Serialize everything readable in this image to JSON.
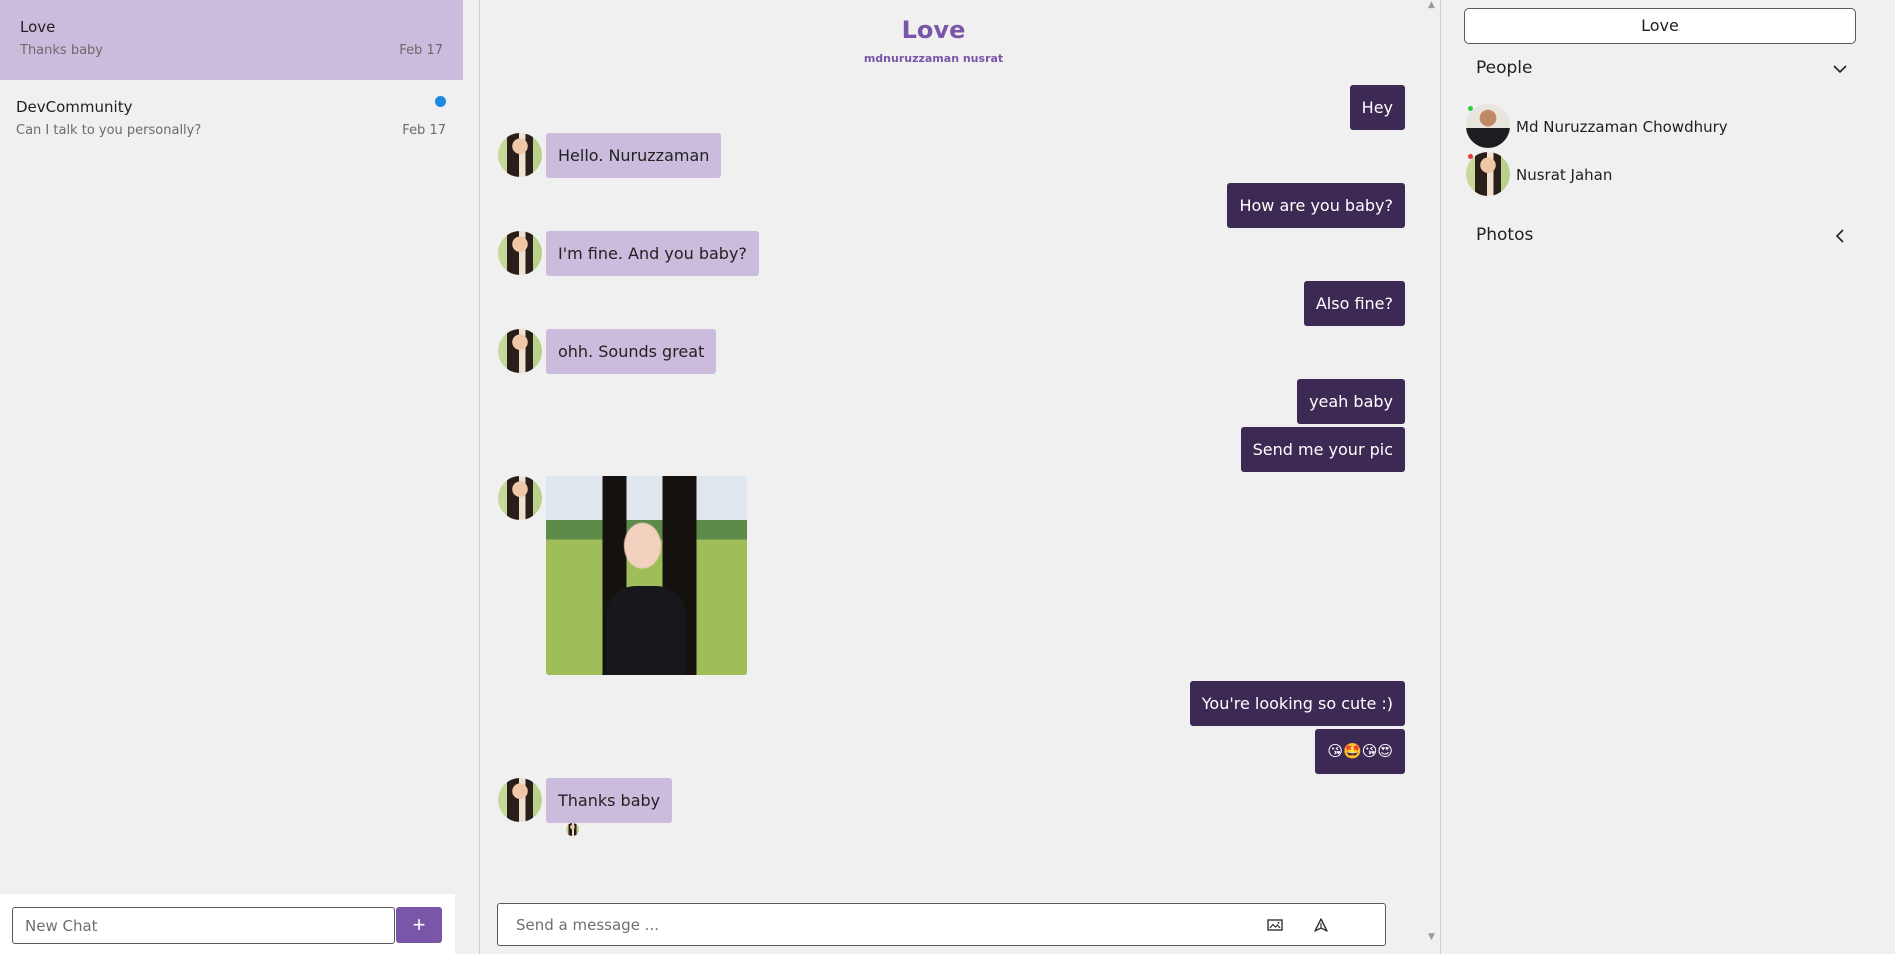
{
  "sidebar": {
    "chats": [
      {
        "title": "Love",
        "last_message": "Thanks baby",
        "date": "Feb 17",
        "active": true,
        "unread": false
      },
      {
        "title": "DevCommunity",
        "last_message": "Can I talk to you personally?",
        "date": "Feb 17",
        "active": false,
        "unread": true
      }
    ],
    "new_chat": {
      "placeholder": "New Chat",
      "add_label": "+"
    }
  },
  "header": {
    "title": "Love",
    "subtitle": "mdnuruzzaman nusrat"
  },
  "messages": [
    {
      "direction": "out",
      "text": "Hey"
    },
    {
      "direction": "in",
      "text": "Hello. Nuruzzaman"
    },
    {
      "direction": "out",
      "text": "How are you baby?"
    },
    {
      "direction": "in",
      "text": "I'm fine. And you baby?"
    },
    {
      "direction": "out",
      "text": "Also fine?"
    },
    {
      "direction": "in",
      "text": "ohh. Sounds great"
    },
    {
      "direction": "out",
      "text": "yeah baby"
    },
    {
      "direction": "out",
      "text": "Send me your pic"
    },
    {
      "direction": "in",
      "type": "image"
    },
    {
      "direction": "out",
      "text": "You're looking so cute :)"
    },
    {
      "direction": "out",
      "text": "😘🤩😘😍"
    },
    {
      "direction": "in",
      "text": "Thanks baby"
    }
  ],
  "composer": {
    "placeholder": "Send a message ...",
    "attach_icon": "image-icon",
    "send_icon": "send-icon"
  },
  "right_panel": {
    "chat_title": "Love",
    "people_label": "People",
    "people": [
      {
        "name": "Md Nuruzzaman Chowdhury",
        "status_color": "#2ecc40"
      },
      {
        "name": "Nusrat Jahan",
        "status_color": "#e53935"
      }
    ],
    "photos_label": "Photos"
  },
  "colors": {
    "accent": "#7a56a8",
    "outgoing_bubble": "#3c2a54",
    "incoming_bubble": "#cbbbdd",
    "unread_dot": "#1e88e5"
  }
}
